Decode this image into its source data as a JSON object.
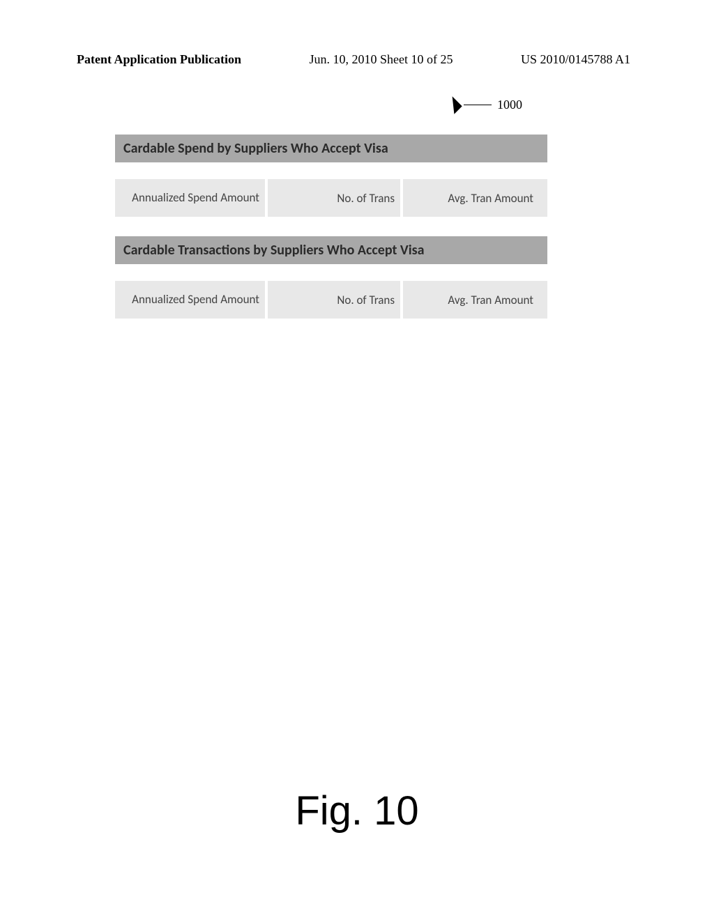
{
  "header": {
    "left": "Patent Application Publication",
    "center": "Jun. 10, 2010  Sheet 10 of 25",
    "right": "US 2010/0145788 A1"
  },
  "figure_ref": "1000",
  "sections": [
    {
      "title": "Cardable Spend by Suppliers Who Accept Visa",
      "columns": [
        "Annualized Spend Amount",
        "No. of Trans",
        "Avg. Tran Amount"
      ]
    },
    {
      "title": "Cardable Transactions by Suppliers Who Accept Visa",
      "columns": [
        "Annualized Spend Amount",
        "No. of Trans",
        "Avg. Tran Amount"
      ]
    }
  ],
  "figure_caption": "Fig. 10"
}
